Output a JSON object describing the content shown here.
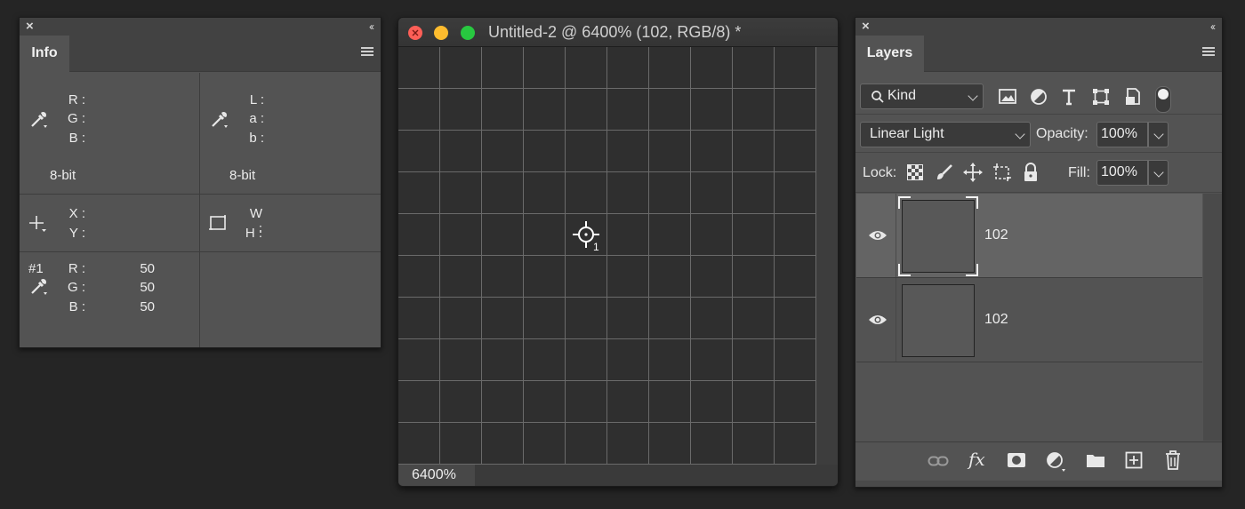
{
  "info_panel": {
    "tab": "Info",
    "rgb_labels": [
      "R :",
      "G :",
      "B :"
    ],
    "lab_labels": [
      "L :",
      "a :",
      "b :"
    ],
    "bit_depth_left": "8-bit",
    "bit_depth_right": "8-bit",
    "xy_labels": [
      "X :",
      "Y :"
    ],
    "wh_labels": [
      "W :",
      "H :"
    ],
    "sampler": {
      "id": "#1",
      "labels": [
        "R :",
        "G :",
        "B :"
      ],
      "values": [
        "50",
        "50",
        "50"
      ]
    },
    "icons": [
      "eyedropper-icon",
      "eyedropper-icon",
      "crosshair-icon",
      "selection-box-icon",
      "eyedropper-icon"
    ]
  },
  "document": {
    "title": "Untitled-2 @ 6400% (102, RGB/8) *",
    "zoom": "6400%",
    "sampler_marker": "1",
    "traffic_lights": [
      "#fe5f57",
      "#febc2e",
      "#28c840"
    ]
  },
  "layers_panel": {
    "tab": "Layers",
    "filter": {
      "label": "Kind"
    },
    "filter_icons": [
      "image-filter-icon",
      "adjustment-filter-icon",
      "type-filter-icon",
      "shape-filter-icon",
      "smart-object-filter-icon"
    ],
    "blend_mode": "Linear Light",
    "opacity_label": "Opacity:",
    "opacity": "100%",
    "lock_label": "Lock:",
    "fill_label": "Fill:",
    "fill": "100%",
    "layers": [
      {
        "name": "102",
        "visible": true,
        "selected": true
      },
      {
        "name": "102",
        "visible": true,
        "selected": false
      }
    ],
    "footer_icons": [
      "link-icon",
      "fx-icon",
      "mask-icon",
      "adjustment-icon",
      "folder-icon",
      "new-layer-icon",
      "trash-icon"
    ],
    "fx_label": "fx"
  },
  "colors": {
    "panel_bg": "#535353",
    "canvas_bg": "#2f2f2f",
    "selected_layer": "#646464"
  }
}
